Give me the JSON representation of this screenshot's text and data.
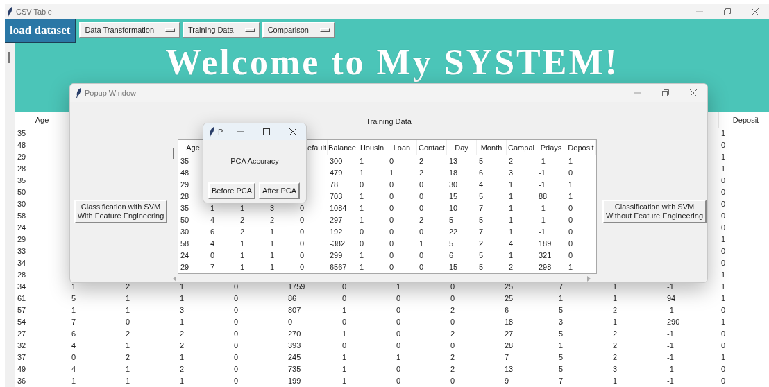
{
  "window": {
    "title": "CSV Table"
  },
  "toolbar": {
    "load_button": "load dataset",
    "menus": [
      "Data Transformation",
      "Training Data",
      "Comparison"
    ]
  },
  "banner": {
    "heading": "Welcome to My SYSTEM!"
  },
  "main_table": {
    "columns": [
      "Age",
      null,
      null,
      null,
      null,
      null,
      null,
      null,
      null,
      null,
      null,
      null,
      null,
      "Deposit"
    ],
    "rows": [
      [
        "35",
        null,
        null,
        null,
        null,
        null,
        null,
        null,
        null,
        null,
        null,
        null,
        null,
        "1"
      ],
      [
        "48",
        null,
        null,
        null,
        null,
        null,
        null,
        null,
        null,
        null,
        null,
        null,
        null,
        "0"
      ],
      [
        "29",
        null,
        null,
        null,
        null,
        null,
        null,
        null,
        null,
        null,
        null,
        null,
        null,
        "1"
      ],
      [
        "28",
        null,
        null,
        null,
        null,
        null,
        null,
        null,
        null,
        null,
        null,
        null,
        null,
        "1"
      ],
      [
        "35",
        null,
        null,
        null,
        null,
        null,
        null,
        null,
        null,
        null,
        null,
        null,
        null,
        "0"
      ],
      [
        "50",
        null,
        null,
        null,
        null,
        null,
        null,
        null,
        null,
        null,
        null,
        null,
        null,
        "0"
      ],
      [
        "30",
        null,
        null,
        null,
        null,
        null,
        null,
        null,
        null,
        null,
        null,
        null,
        null,
        "0"
      ],
      [
        "58",
        null,
        null,
        null,
        null,
        null,
        null,
        null,
        null,
        null,
        null,
        null,
        null,
        "0"
      ],
      [
        "24",
        null,
        null,
        null,
        null,
        null,
        null,
        null,
        null,
        null,
        null,
        null,
        null,
        "0"
      ],
      [
        "29",
        null,
        null,
        null,
        null,
        null,
        null,
        null,
        null,
        null,
        null,
        null,
        null,
        "1"
      ],
      [
        "33",
        null,
        null,
        null,
        null,
        null,
        null,
        null,
        null,
        null,
        null,
        null,
        null,
        "0"
      ],
      [
        "34",
        null,
        null,
        null,
        null,
        null,
        null,
        null,
        null,
        null,
        null,
        null,
        null,
        "0"
      ],
      [
        "28",
        null,
        null,
        null,
        null,
        null,
        null,
        null,
        null,
        null,
        null,
        null,
        null,
        "1"
      ],
      [
        "34",
        "1",
        "2",
        "1",
        "0",
        "1759",
        "0",
        "1",
        "0",
        "25",
        "7",
        "1",
        "-1",
        "1"
      ],
      [
        "61",
        "5",
        "1",
        "1",
        "0",
        "86",
        "0",
        "0",
        "0",
        "25",
        "1",
        "1",
        "94",
        "1"
      ],
      [
        "57",
        "1",
        "1",
        "3",
        "0",
        "807",
        "1",
        "0",
        "2",
        "6",
        "5",
        "2",
        "-1",
        "0"
      ],
      [
        "54",
        "7",
        "0",
        "1",
        "0",
        "0",
        "0",
        "0",
        "0",
        "18",
        "3",
        "1",
        "290",
        "1"
      ],
      [
        "27",
        "6",
        "2",
        "2",
        "0",
        "270",
        "1",
        "0",
        "2",
        "27",
        "5",
        "2",
        "-1",
        "0"
      ],
      [
        "32",
        "4",
        "1",
        "2",
        "0",
        "393",
        "0",
        "0",
        "0",
        "28",
        "1",
        "2",
        "-1",
        "0"
      ],
      [
        "37",
        "0",
        "2",
        "1",
        "0",
        "245",
        "1",
        "1",
        "2",
        "7",
        "5",
        "2",
        "-1",
        "1"
      ],
      [
        "49",
        "4",
        "1",
        "2",
        "0",
        "735",
        "1",
        "0",
        "2",
        "13",
        "5",
        "3",
        "-1",
        "0"
      ],
      [
        "36",
        "1",
        "1",
        "1",
        "0",
        "199",
        "1",
        "0",
        "0",
        "9",
        "7",
        "1",
        "-1",
        "0"
      ]
    ]
  },
  "popup": {
    "title": "Popup Window",
    "heading": "Training Data",
    "left_button": "Classification with SVM\nWith Feature Engineering",
    "right_button": "Classification with SVM\nWithout Feature Engineering",
    "table": {
      "columns": [
        "Age",
        null,
        null,
        null,
        "efault",
        "Balance",
        "Housin",
        "Loan",
        "Contact",
        "Day",
        "Month",
        "Campai",
        "Pdays",
        "Deposit"
      ],
      "rows": [
        [
          "35",
          null,
          null,
          null,
          null,
          "300",
          "1",
          "0",
          "2",
          "13",
          "5",
          "2",
          "-1",
          "1"
        ],
        [
          "48",
          null,
          null,
          null,
          null,
          "479",
          "1",
          "1",
          "2",
          "18",
          "6",
          "3",
          "-1",
          "0"
        ],
        [
          "29",
          null,
          null,
          null,
          null,
          "78",
          "0",
          "0",
          "0",
          "30",
          "4",
          "1",
          "-1",
          "1"
        ],
        [
          "28",
          null,
          null,
          null,
          null,
          "703",
          "1",
          "0",
          "0",
          "15",
          "5",
          "1",
          "88",
          "1"
        ],
        [
          "35",
          "1",
          "1",
          "3",
          "0",
          "1084",
          "1",
          "0",
          "0",
          "10",
          "7",
          "1",
          "-1",
          "0"
        ],
        [
          "50",
          "4",
          "2",
          "2",
          "0",
          "297",
          "1",
          "0",
          "2",
          "5",
          "5",
          "1",
          "-1",
          "0"
        ],
        [
          "30",
          "6",
          "2",
          "1",
          "0",
          "192",
          "0",
          "0",
          "0",
          "22",
          "7",
          "1",
          "-1",
          "0"
        ],
        [
          "58",
          "4",
          "1",
          "1",
          "0",
          "-382",
          "0",
          "0",
          "1",
          "5",
          "2",
          "4",
          "189",
          "0"
        ],
        [
          "24",
          "0",
          "1",
          "1",
          "0",
          "299",
          "1",
          "0",
          "0",
          "6",
          "5",
          "1",
          "321",
          "0"
        ],
        [
          "29",
          "7",
          "1",
          "1",
          "0",
          "6567",
          "1",
          "0",
          "0",
          "15",
          "5",
          "2",
          "298",
          "1"
        ]
      ]
    }
  },
  "pca_dialog": {
    "title": "P",
    "label": "PCA Accuracy",
    "buttons": [
      "Before PCA",
      "After PCA"
    ]
  }
}
